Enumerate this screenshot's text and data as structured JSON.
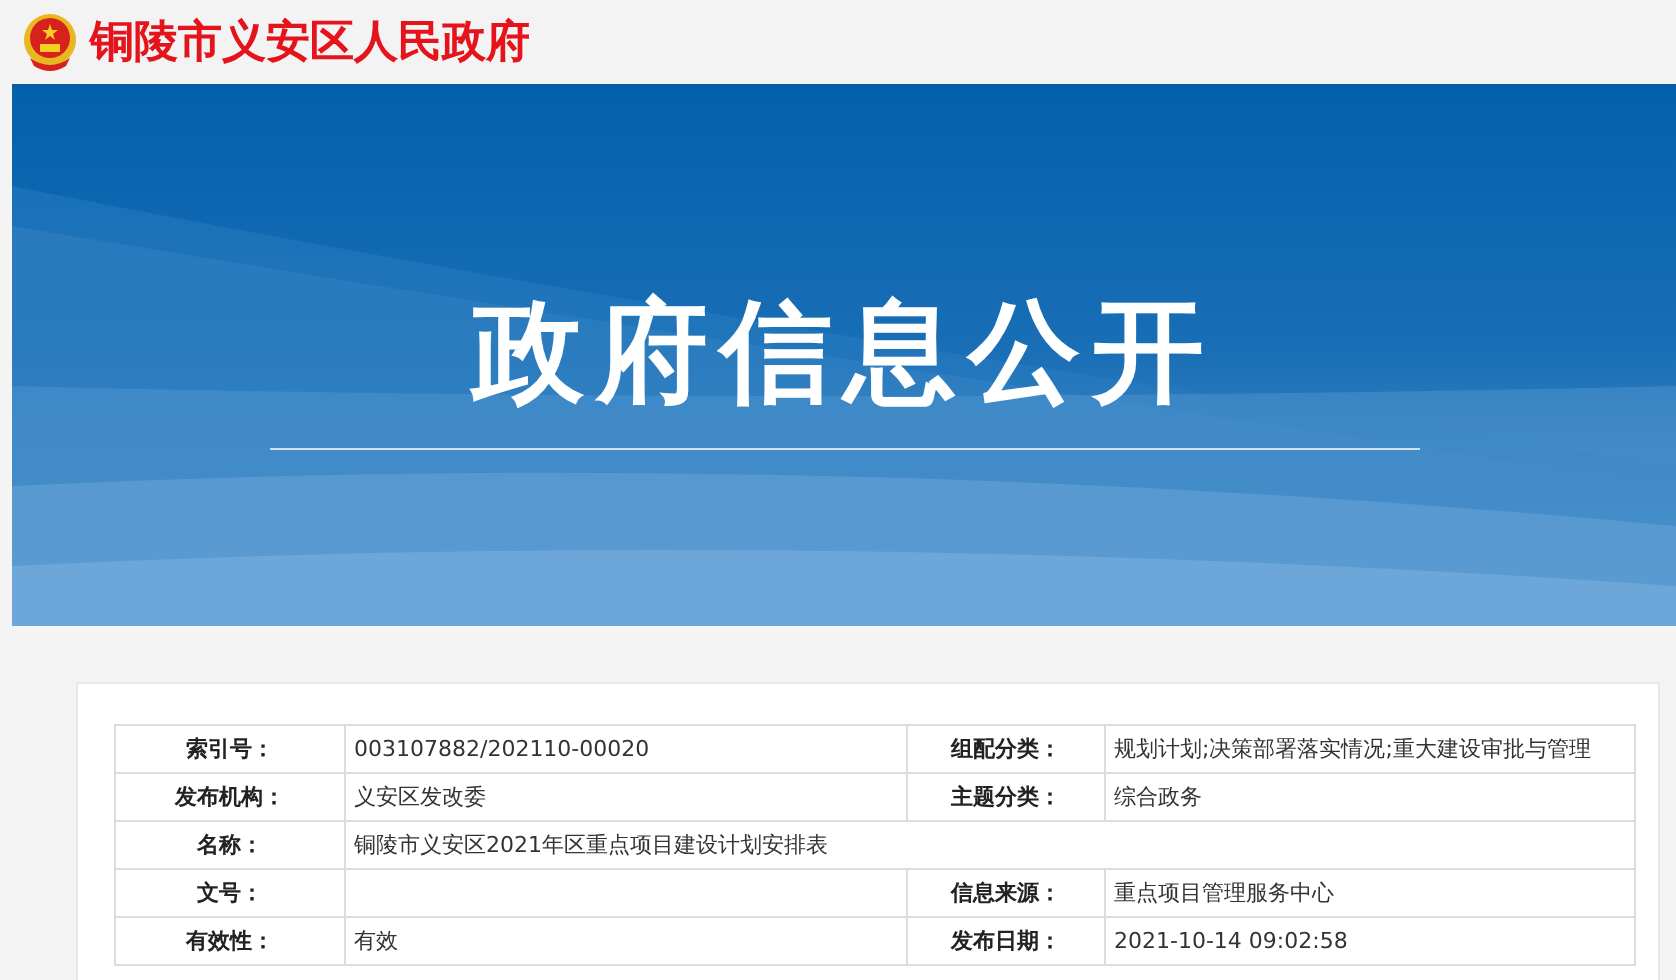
{
  "site": {
    "title": "铜陵市义安区人民政府"
  },
  "banner": {
    "title": "政府信息公开"
  },
  "table": {
    "rows": [
      {
        "cells": [
          {
            "label": "索引号：",
            "value": "003107882/202110-00020"
          },
          {
            "label": "组配分类：",
            "value": "规划计划;决策部署落实情况;重大建设审批与管理"
          }
        ]
      },
      {
        "cells": [
          {
            "label": "发布机构：",
            "value": "义安区发改委"
          },
          {
            "label": "主题分类：",
            "value": "综合政务"
          }
        ]
      },
      {
        "cells": [
          {
            "label": "名称：",
            "value": "铜陵市义安区2021年区重点项目建设计划安排表"
          }
        ]
      },
      {
        "cells": [
          {
            "label": "文号："
          },
          {
            "label": "信息来源：",
            "value": "重点项目管理服务中心"
          }
        ]
      },
      {
        "cells": [
          {
            "label": "有效性：",
            "value": "有效"
          },
          {
            "label": "发布日期：",
            "value": "2021-10-14 09:02:58"
          }
        ]
      }
    ]
  }
}
